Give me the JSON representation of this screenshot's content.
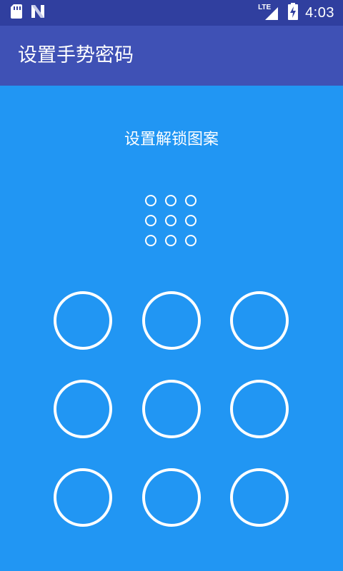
{
  "status_bar": {
    "time": "4:03",
    "network_label": "LTE",
    "icons": [
      "sd-card-icon",
      "notification-n-icon",
      "signal-icon",
      "battery-charging-icon"
    ]
  },
  "app_bar": {
    "title": "设置手势密码"
  },
  "hint": "设置解锁图案",
  "colors": {
    "status_bar": "#303F9F",
    "app_bar": "#3F51B5",
    "background": "#2196F3",
    "foreground": "#FFFFFF"
  }
}
